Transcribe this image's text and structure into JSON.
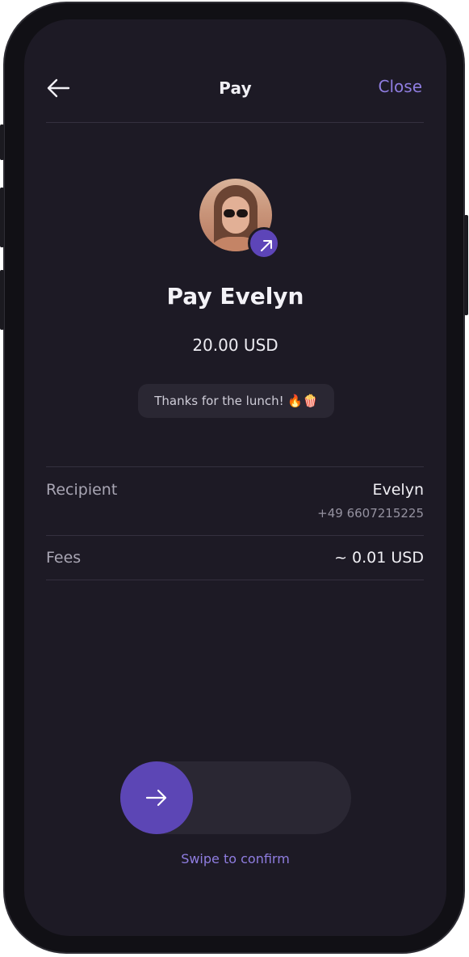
{
  "header": {
    "title": "Pay",
    "close_label": "Close"
  },
  "recipient_card": {
    "heading": "Pay Evelyn",
    "amount": "20.00 USD",
    "note": "Thanks for the lunch! 🔥🍿"
  },
  "details": {
    "recipient_label": "Recipient",
    "recipient_name": "Evelyn",
    "recipient_phone": "+49 6607215225",
    "fees_label": "Fees",
    "fees_value": "~ 0.01 USD"
  },
  "swipe": {
    "hint": "Swipe to confirm",
    "progress": 0
  },
  "icons": {
    "back": "arrow-left-icon",
    "badge": "arrow-up-right-icon",
    "knob": "arrow-right-icon"
  },
  "colors": {
    "background": "#1d1a25",
    "accent": "#5c46b5",
    "accent_text": "#8f7de0"
  }
}
